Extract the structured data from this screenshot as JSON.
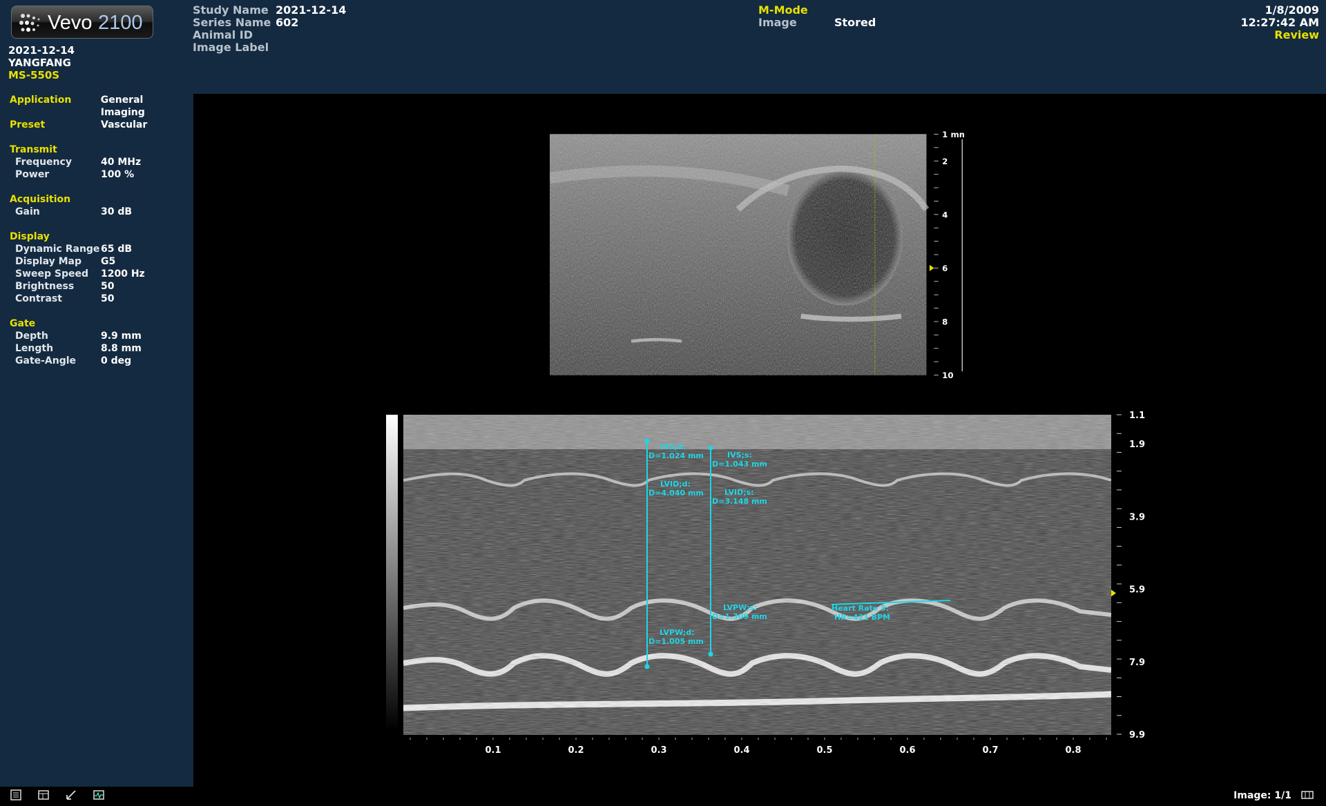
{
  "app": {
    "brand": "Vevo",
    "model": "2100"
  },
  "header_left": {
    "date": "2021-12-14",
    "operator": "YANGFANG",
    "transducer": "MS-550S"
  },
  "study": [
    {
      "label": "Study Name",
      "value": "2021-12-14"
    },
    {
      "label": "Series Name",
      "value": "602"
    },
    {
      "label": "Animal ID",
      "value": ""
    },
    {
      "label": "Image Label",
      "value": ""
    }
  ],
  "mode": {
    "name": "M-Mode",
    "image_label": "Image",
    "image_value": "Stored"
  },
  "header_right": {
    "date": "1/8/2009",
    "time": "12:27:42 AM",
    "status": "Review"
  },
  "params": {
    "application_label": "Application",
    "application": "General Imaging",
    "preset_label": "Preset",
    "preset": "Vascular",
    "sections": [
      {
        "title": "Transmit",
        "rows": [
          {
            "k": "Frequency",
            "v": "40 MHz"
          },
          {
            "k": "Power",
            "v": "100 %"
          }
        ]
      },
      {
        "title": "Acquisition",
        "rows": [
          {
            "k": "Gain",
            "v": "30 dB"
          }
        ]
      },
      {
        "title": "Display",
        "rows": [
          {
            "k": "Dynamic Range",
            "v": "65 dB"
          },
          {
            "k": "Display Map",
            "v": "G5"
          },
          {
            "k": "Sweep Speed",
            "v": "1200 Hz"
          },
          {
            "k": "Brightness",
            "v": "50"
          },
          {
            "k": "Contrast",
            "v": "50"
          }
        ]
      },
      {
        "title": "Gate",
        "rows": [
          {
            "k": "Depth",
            "v": "9.9 mm"
          },
          {
            "k": "Length",
            "v": "8.8 mm"
          },
          {
            "k": "Gate-Angle",
            "v": "0 deg"
          }
        ]
      }
    ]
  },
  "bmode_scale": {
    "unit_label": "1 mm",
    "labels": [
      "2",
      "4",
      "6",
      "8",
      "10"
    ]
  },
  "mmode_scale": {
    "depth_labels": [
      "1.1",
      "1.9",
      "3.9",
      "5.9",
      "7.9",
      "9.9"
    ],
    "time_labels": [
      "0.1",
      "0.2",
      "0.3",
      "0.4",
      "0.5",
      "0.6",
      "0.7",
      "0.8"
    ]
  },
  "measurements": [
    {
      "name": "IVS;d:",
      "value": "D=1.024 mm"
    },
    {
      "name": "IVS;s:",
      "value": "D=1.043 mm"
    },
    {
      "name": "LVID;d:",
      "value": "D=4.040 mm"
    },
    {
      "name": "LVID;s:",
      "value": "D=3.148 mm"
    },
    {
      "name": "LVPW;s:",
      "value": "D=1.309 mm"
    },
    {
      "name": "LVPW;d:",
      "value": "D=1.005 mm"
    },
    {
      "name": "Heart Rate 3:",
      "value": "HR=421 BPM"
    }
  ],
  "colors": {
    "panel": "#142a40",
    "accent_yellow": "#e8e000",
    "measure_cyan": "#1ed6e6"
  },
  "footer": {
    "image_counter": "Image: 1/1",
    "tools": [
      "report-icon",
      "image-settings-icon",
      "measure-tool-icon",
      "physio-icon",
      "layout-icon"
    ]
  }
}
